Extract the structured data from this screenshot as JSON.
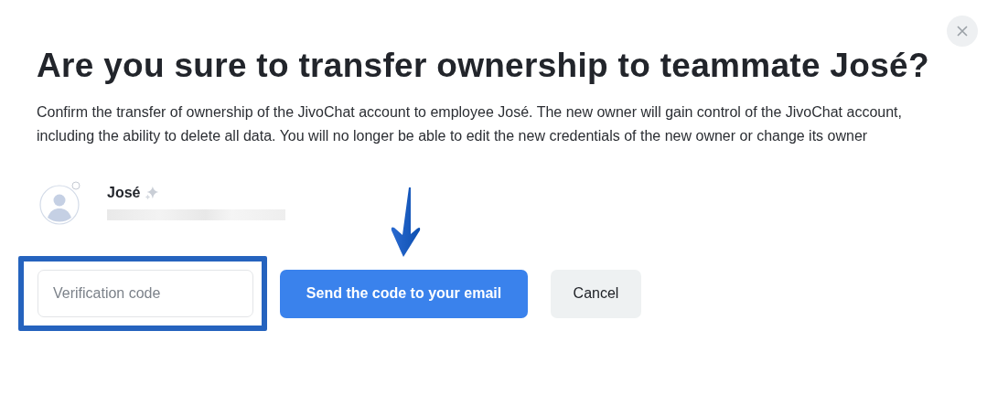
{
  "dialog": {
    "title": "Are you sure to transfer ownership to teammate José?",
    "description": "Confirm the transfer of ownership of the JivoChat account to employee José. The new owner will gain control of the JivoChat account, including the ability to delete all data. You will no longer be able to edit the new credentials of the new owner or change its owner"
  },
  "user": {
    "name": "José",
    "email_redacted": true
  },
  "verification": {
    "placeholder": "Verification code",
    "highlighted": true
  },
  "buttons": [
    {
      "kind": "primary",
      "label": "Send the code to your email",
      "pointed": true
    },
    {
      "kind": "secondary",
      "label": "Cancel",
      "pointed": false
    }
  ]
}
